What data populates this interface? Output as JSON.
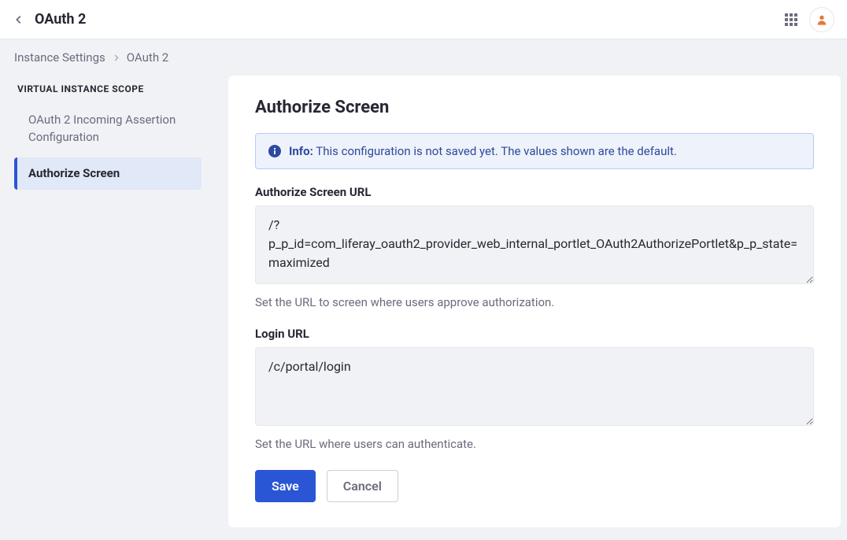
{
  "topbar": {
    "title": "OAuth 2"
  },
  "breadcrumb": {
    "items": [
      "Instance Settings",
      "OAuth 2"
    ]
  },
  "sidebar": {
    "scope_heading": "VIRTUAL INSTANCE SCOPE",
    "items": [
      {
        "label": "OAuth 2 Incoming Assertion Configuration",
        "active": false
      },
      {
        "label": "Authorize Screen",
        "active": true
      }
    ]
  },
  "panel": {
    "heading": "Authorize Screen",
    "alert": {
      "prefix": "Info:",
      "text": " This configuration is not saved yet. The values shown are the default."
    },
    "fields": {
      "authorize_url": {
        "label": "Authorize Screen URL",
        "value": "/?p_p_id=com_liferay_oauth2_provider_web_internal_portlet_OAuth2AuthorizePortlet&p_p_state=maximized",
        "help": "Set the URL to screen where users approve authorization."
      },
      "login_url": {
        "label": "Login URL",
        "value": "/c/portal/login",
        "help": "Set the URL where users can authenticate."
      }
    },
    "buttons": {
      "save": "Save",
      "cancel": "Cancel"
    }
  }
}
